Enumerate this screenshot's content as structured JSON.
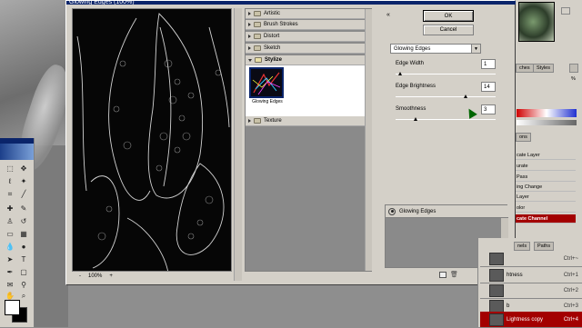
{
  "dialog": {
    "title": "Glowing Edges (100%)",
    "zoom": "100%",
    "zoom_minus": "-",
    "zoom_plus": "+",
    "ok_label": "OK",
    "cancel_label": "Cancel",
    "collapse_glyph": "«"
  },
  "gallery": {
    "categories": [
      {
        "label": "Artistic",
        "expanded": false
      },
      {
        "label": "Brush Strokes",
        "expanded": false
      },
      {
        "label": "Distort",
        "expanded": false
      },
      {
        "label": "Sketch",
        "expanded": false
      },
      {
        "label": "Stylize",
        "expanded": true
      },
      {
        "label": "Texture",
        "expanded": false
      }
    ],
    "selected_filter": "Glowing Edges"
  },
  "settings": {
    "filter_select": "Glowing Edges",
    "edge_width_label": "Edge Width",
    "edge_width_value": "1",
    "edge_width_level": 0.05,
    "edge_brightness_label": "Edge Brightness",
    "edge_brightness_value": "14",
    "edge_brightness_level": 0.7,
    "smoothness_label": "Smoothness",
    "smoothness_value": "3",
    "smoothness_level": 0.2
  },
  "effect_layers": {
    "row_label": "Glowing Edges"
  },
  "palettes": {
    "tabs": {
      "swatches_partial": "ches",
      "styles": "Styles",
      "actions_partial": "ons",
      "channels_partial": "nels",
      "paths": "Paths"
    },
    "pct_label": "%",
    "actions": [
      "cate Layer",
      "urate",
      "Pass",
      "ing Change",
      "Layer",
      "olor",
      "cate Channel"
    ],
    "layers": [
      {
        "name": "",
        "key": "Ctrl+~"
      },
      {
        "name": "htness",
        "key": "Ctrl+1"
      },
      {
        "name": "",
        "key": "Ctrl+2"
      },
      {
        "name": "b",
        "key": "Ctrl+3"
      },
      {
        "name": "Lightness copy",
        "key": "Ctrl+4"
      }
    ]
  },
  "colors": {
    "accent_selected": "#a30000",
    "dialog_bg": "#d4d0c8",
    "title_bar": "#0a246a"
  }
}
